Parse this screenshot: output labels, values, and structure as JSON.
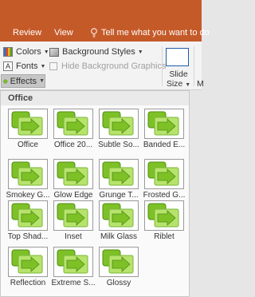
{
  "ribbon_tabs": {
    "review": "Review",
    "view": "View",
    "tell_me": "Tell me what you want to do"
  },
  "ribbon": {
    "colors": "Colors",
    "background_styles": "Background Styles",
    "fonts": "Fonts",
    "hide_background_graphics": "Hide Background Graphics",
    "effects": "Effects",
    "slide_size_line1": "Slide",
    "slide_size_line2": "Size",
    "partial_label": "M"
  },
  "icons": {
    "fonts_glyph": "A"
  },
  "gallery": {
    "section_title": "Office",
    "items": [
      "Office",
      "Office 20...",
      "Subtle So...",
      "Banded E...",
      "Smokey G...",
      "Glow Edge",
      "Grunge T...",
      "Frosted G...",
      "Top Shad...",
      "Inset",
      "Milk Glass",
      "Riblet",
      "Reflection",
      "Extreme S...",
      "Glossy"
    ]
  },
  "colors": {
    "ribbon_tab_bg": "#c55a29",
    "effect_green": "#7dc127",
    "effect_light": "#b7e36d"
  }
}
